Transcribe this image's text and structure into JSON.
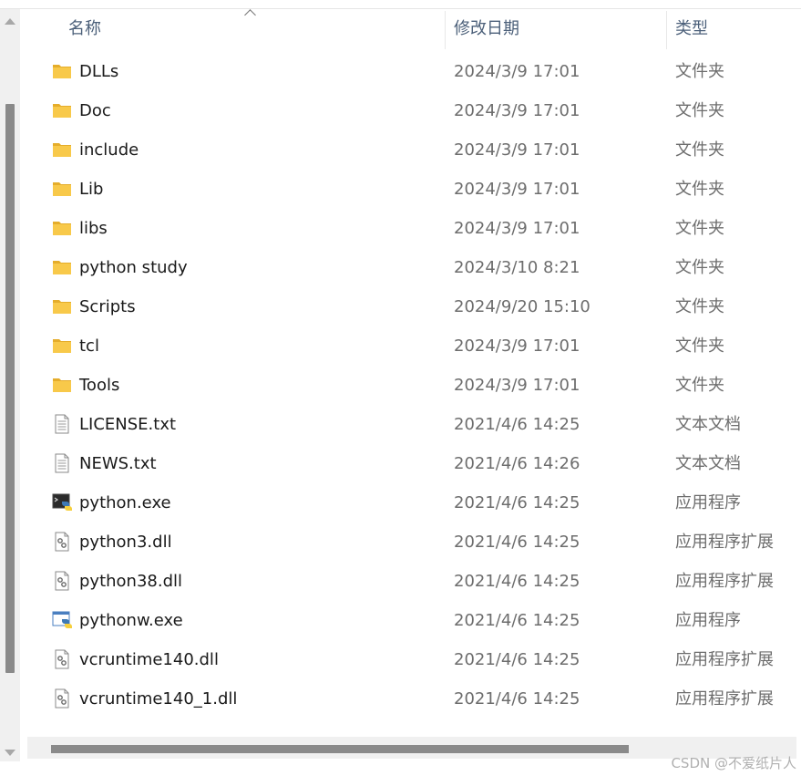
{
  "columns": {
    "name": "名称",
    "date": "修改日期",
    "type": "类型"
  },
  "files": [
    {
      "name": "DLLs",
      "date": "2024/3/9 17:01",
      "type": "文件夹",
      "icon": "folder-icon"
    },
    {
      "name": "Doc",
      "date": "2024/3/9 17:01",
      "type": "文件夹",
      "icon": "folder-icon"
    },
    {
      "name": "include",
      "date": "2024/3/9 17:01",
      "type": "文件夹",
      "icon": "folder-icon"
    },
    {
      "name": "Lib",
      "date": "2024/3/9 17:01",
      "type": "文件夹",
      "icon": "folder-icon"
    },
    {
      "name": "libs",
      "date": "2024/3/9 17:01",
      "type": "文件夹",
      "icon": "folder-icon"
    },
    {
      "name": "python study",
      "date": "2024/3/10 8:21",
      "type": "文件夹",
      "icon": "folder-icon"
    },
    {
      "name": "Scripts",
      "date": "2024/9/20 15:10",
      "type": "文件夹",
      "icon": "folder-icon"
    },
    {
      "name": "tcl",
      "date": "2024/3/9 17:01",
      "type": "文件夹",
      "icon": "folder-icon"
    },
    {
      "name": "Tools",
      "date": "2024/3/9 17:01",
      "type": "文件夹",
      "icon": "folder-icon"
    },
    {
      "name": "LICENSE.txt",
      "date": "2021/4/6 14:25",
      "type": "文本文档",
      "icon": "text-file-icon"
    },
    {
      "name": "NEWS.txt",
      "date": "2021/4/6 14:26",
      "type": "文本文档",
      "icon": "text-file-icon"
    },
    {
      "name": "python.exe",
      "date": "2021/4/6 14:25",
      "type": "应用程序",
      "icon": "python-console-icon"
    },
    {
      "name": "python3.dll",
      "date": "2021/4/6 14:25",
      "type": "应用程序扩展",
      "icon": "dll-file-icon"
    },
    {
      "name": "python38.dll",
      "date": "2021/4/6 14:25",
      "type": "应用程序扩展",
      "icon": "dll-file-icon"
    },
    {
      "name": "pythonw.exe",
      "date": "2021/4/6 14:25",
      "type": "应用程序",
      "icon": "python-window-icon"
    },
    {
      "name": "vcruntime140.dll",
      "date": "2021/4/6 14:25",
      "type": "应用程序扩展",
      "icon": "dll-file-icon"
    },
    {
      "name": "vcruntime140_1.dll",
      "date": "2021/4/6 14:25",
      "type": "应用程序扩展",
      "icon": "dll-file-icon"
    }
  ],
  "watermark": "CSDN @不爱纸片人",
  "colors": {
    "folder": "#f8c94a",
    "header_text": "#4c607a",
    "secondary_text": "#6d6d6d",
    "scroll_thumb": "#8a8a8a"
  }
}
